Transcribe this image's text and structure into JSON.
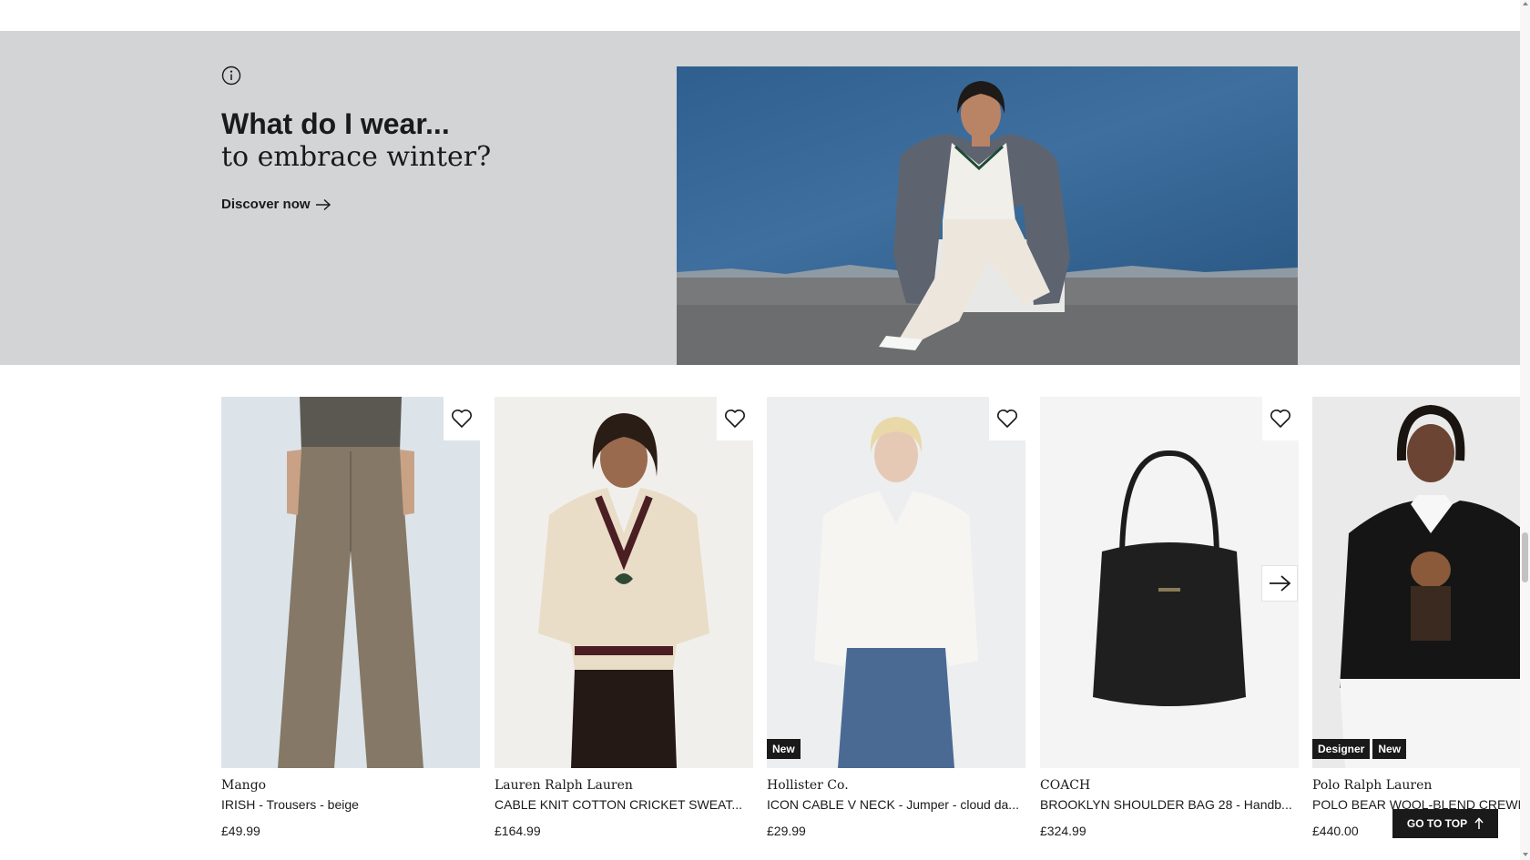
{
  "hero": {
    "title": "What do I wear...",
    "subtitle": "to embrace winter?",
    "cta_label": "Discover now"
  },
  "products": [
    {
      "brand": "Mango",
      "name": "IRISH - Trousers - beige",
      "price": "£49.99",
      "badges": []
    },
    {
      "brand": "Lauren Ralph Lauren",
      "name": "CABLE KNIT COTTON CRICKET SWEAT...",
      "price": "£164.99",
      "badges": []
    },
    {
      "brand": "Hollister Co.",
      "name": "ICON CABLE V NECK - Jumper - cloud da...",
      "price": "£29.99",
      "badges": [
        "New"
      ]
    },
    {
      "brand": "COACH",
      "name": "BROOKLYN SHOULDER BAG 28 - Handb...",
      "price": "£324.99",
      "badges": []
    },
    {
      "brand": "Polo Ralph Lauren",
      "name": "POLO BEAR WOOL-BLEND CREWNECK",
      "price": "£440.00",
      "badges": [
        "Designer",
        "New"
      ]
    }
  ],
  "go_top_label": "GO TO TOP",
  "icons": {
    "info": "info-icon",
    "arrow": "arrow-right-icon",
    "wishlist": "heart-icon",
    "go_top": "arrow-up-icon"
  },
  "colors": {
    "hero_bg": "#d3d4d5",
    "text": "#1a1a1a",
    "badge_bg": "#1a1a1a",
    "photo_wall": "#3e6a96"
  }
}
